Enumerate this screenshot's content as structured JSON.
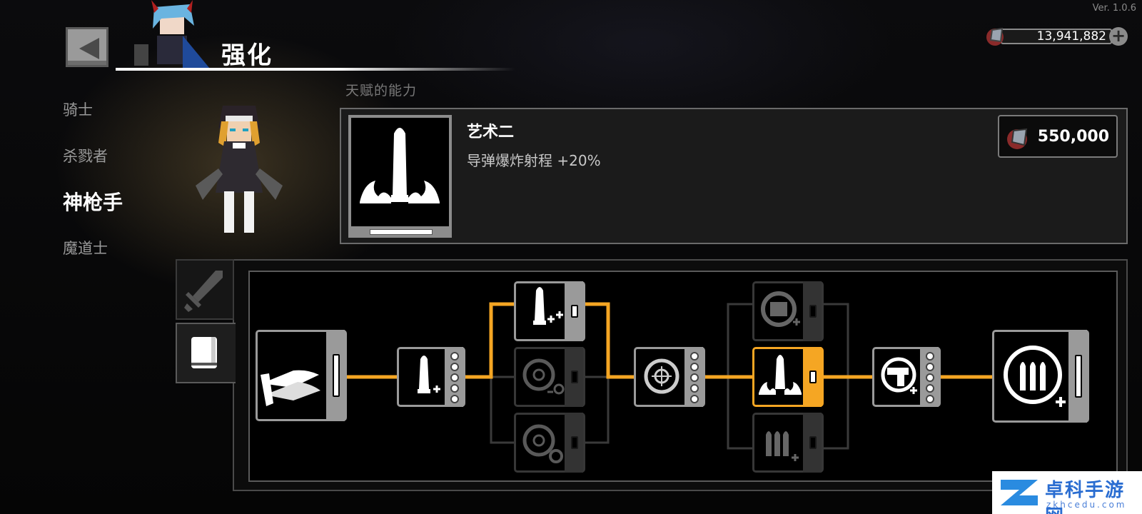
{
  "version": "Ver. 1.0.6",
  "header": {
    "title": "强化"
  },
  "currency": {
    "amount": "13,941,882",
    "add_icon": "plus-icon",
    "gem_icon": "gem-icon"
  },
  "side_nav": {
    "items": [
      {
        "label": "骑士",
        "active": false
      },
      {
        "label": "杀戮者",
        "active": false
      },
      {
        "label": "神枪手",
        "active": true
      },
      {
        "label": "魔道士",
        "active": false
      }
    ]
  },
  "detail": {
    "label_obscured": "天赋的能力",
    "name": "艺术二",
    "description": "导弹爆炸射程 +20%",
    "cost": "550,000",
    "icon": "missile-blast-icon"
  },
  "tabs": [
    {
      "icon": "sword-icon",
      "active": false
    },
    {
      "icon": "book-icon",
      "active": true
    }
  ],
  "tree": {
    "nodes": [
      {
        "id": "root",
        "icon": "twin-missile-icon",
        "state": "unlocked"
      },
      {
        "id": "missile-plus",
        "icon": "missile-plus-icon",
        "state": "unlocked",
        "pips": 5
      },
      {
        "id": "missile-plusplus",
        "icon": "missile-double-plus-icon",
        "state": "unlocked"
      },
      {
        "id": "target-minus",
        "icon": "target-gear-icon",
        "state": "locked"
      },
      {
        "id": "target-gear",
        "icon": "target-gear-icon",
        "state": "locked"
      },
      {
        "id": "target",
        "icon": "target-icon",
        "state": "unlocked",
        "pips": 5
      },
      {
        "id": "gear-plus",
        "icon": "gear-shield-icon",
        "state": "locked"
      },
      {
        "id": "missile-blast",
        "icon": "missile-blast-icon",
        "state": "selected"
      },
      {
        "id": "ammo-plus",
        "icon": "ammo-plus-icon",
        "state": "locked"
      },
      {
        "id": "gun-target",
        "icon": "gun-target-icon",
        "state": "unlocked",
        "pips": 5
      },
      {
        "id": "final",
        "icon": "triple-ammo-ring-icon",
        "state": "unlocked"
      }
    ]
  },
  "watermark": {
    "title": "卓科手游网",
    "subtitle": "zkhcedu.com"
  },
  "colors": {
    "accent": "#f5a623",
    "panel": "#1b1b1b",
    "border": "#9a9a9a"
  }
}
